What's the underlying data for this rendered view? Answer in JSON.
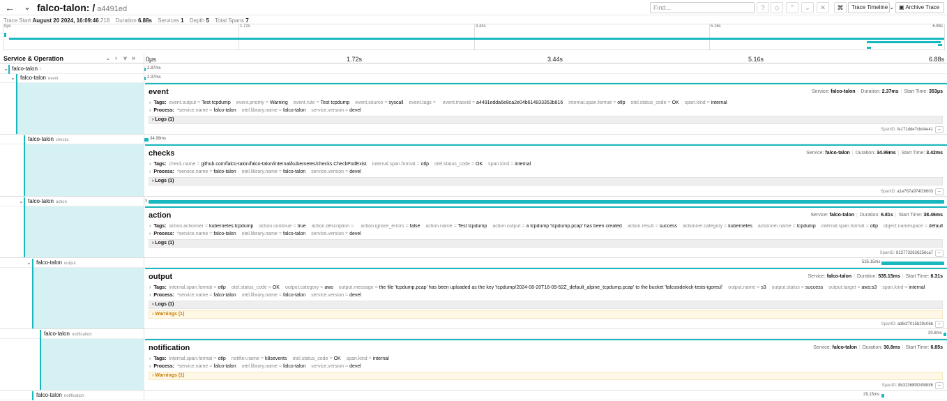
{
  "header": {
    "title": "falco-talon: /",
    "trace_id": "a4491ed",
    "find_placeholder": "Find...",
    "view_label": "Trace Timeline",
    "archive_label": "Archive Trace"
  },
  "summary": {
    "trace_start_label": "Trace Start",
    "trace_start_date": "August 20 2024, 16:09:46",
    "trace_start_ms": ".218",
    "duration_label": "Duration",
    "duration": "6.88s",
    "services_label": "Services",
    "services": "1",
    "depth_label": "Depth",
    "depth": "5",
    "spans_label": "Total Spans",
    "spans": "7"
  },
  "timeline": {
    "ticks": [
      "0μs",
      "1.72s",
      "3.44s",
      "5.16s",
      "6.88s"
    ],
    "service_operation_label": "Service & Operation"
  },
  "rows": [
    {
      "service": "falco-talon",
      "op": "/",
      "duration": "2.87ms"
    },
    {
      "service": "falco-talon",
      "op": "event",
      "duration": "2.37ms"
    },
    {
      "service": "falco-talon",
      "op": "checks",
      "duration": "34.99ms"
    },
    {
      "service": "falco-talon",
      "op": "action",
      "duration": "s"
    },
    {
      "service": "falco-talon",
      "op": "output",
      "duration": "535.15ms"
    },
    {
      "service": "falco-talon",
      "op": "notification",
      "duration": "30.8ms"
    },
    {
      "service": "falco-talon",
      "op": "notification",
      "duration": "29.15ms"
    }
  ],
  "details": {
    "labels": {
      "service": "Service:",
      "duration": "Duration:",
      "start": "Start Time:",
      "tags": "Tags:",
      "process": "Process:",
      "logs": "Logs (1)",
      "warnings": "Warnings (1)",
      "spanid": "SpanID:"
    },
    "event": {
      "title": "event",
      "service": "falco-talon",
      "duration": "2.37ms",
      "start": "353μs",
      "tags": [
        {
          "k": "event.output",
          "v": "Test tcpdump"
        },
        {
          "k": "event.priority",
          "v": "Warning"
        },
        {
          "k": "event.rule",
          "v": "Test tcpdump"
        },
        {
          "k": "event.source",
          "v": "syscall"
        },
        {
          "k": "event.tags",
          "v": ""
        },
        {
          "k": "event.traceid",
          "v": "a4491edda6e8ca2e04b614833353b816"
        },
        {
          "k": "internal.span.format",
          "v": "otlp"
        },
        {
          "k": "otel.status_code",
          "v": "OK"
        },
        {
          "k": "span.kind",
          "v": "internal"
        }
      ],
      "spanid": "fe171dde7cbd4e41"
    },
    "checks": {
      "title": "checks",
      "service": "falco-talon",
      "duration": "34.99ms",
      "start": "3.42ms",
      "tags": [
        {
          "k": "check.name",
          "v": "github.com/falco-talon/falco-talon/internal/kubernetes/checks.CheckPodExist"
        },
        {
          "k": "internal.span.format",
          "v": "otlp"
        },
        {
          "k": "otel.status_code",
          "v": "OK"
        },
        {
          "k": "span.kind",
          "v": "internal"
        }
      ],
      "spanid": "a1e767a974f26603"
    },
    "action": {
      "title": "action",
      "service": "falco-talon",
      "duration": "6.81s",
      "start": "38.46ms",
      "tags": [
        {
          "k": "action.actionner",
          "v": "kubernetes:tcpdump"
        },
        {
          "k": "action.continue",
          "v": "true"
        },
        {
          "k": "action.description",
          "v": ""
        },
        {
          "k": "action.ignore_errors",
          "v": "false"
        },
        {
          "k": "action.name",
          "v": "Test tcpdump"
        },
        {
          "k": "action.output",
          "v": "a tcpdump 'tcpdump.pcap' has been created"
        },
        {
          "k": "action.result",
          "v": "success"
        },
        {
          "k": "actionner.category",
          "v": "kubernetes"
        },
        {
          "k": "actionner.name",
          "v": "tcpdump"
        },
        {
          "k": "internal.span.format",
          "v": "otlp"
        },
        {
          "k": "object.namespace",
          "v": "default..."
        }
      ],
      "spanid": "8137732626256ca7"
    },
    "output": {
      "title": "output",
      "service": "falco-talon",
      "duration": "535.15ms",
      "start": "6.31s",
      "tags": [
        {
          "k": "internal.span.format",
          "v": "otlp"
        },
        {
          "k": "otel.status_code",
          "v": "OK"
        },
        {
          "k": "output.category",
          "v": "aws"
        },
        {
          "k": "output.message",
          "v": "the file 'tcpdump.pcap' has been uploaded as the key 'tcpdump/2024-08-20T16-09-52Z_default_alpine_tcpdump.pcap' to the bucket 'falcosidekick-tests-igoreul'"
        },
        {
          "k": "output.name",
          "v": "s3"
        },
        {
          "k": "output.status",
          "v": "success"
        },
        {
          "k": "output.target",
          "v": "aws:s3"
        },
        {
          "k": "span.kind",
          "v": "internal"
        }
      ],
      "spanid": "ad6cf7015b29c06b"
    },
    "notification": {
      "title": "notification",
      "service": "falco-talon",
      "duration": "30.8ms",
      "start": "6.85s",
      "tags": [
        {
          "k": "internal.span.format",
          "v": "otlp"
        },
        {
          "k": "notifier.name",
          "v": "k8sevents"
        },
        {
          "k": "otel.status_code",
          "v": "OK"
        },
        {
          "k": "span.kind",
          "v": "internal"
        }
      ],
      "spanid": "8b32368f82458bf6"
    },
    "process": [
      {
        "k": "*service.name",
        "v": "falco-talon"
      },
      {
        "k": "otel.library.name",
        "v": "falco-talon"
      },
      {
        "k": "service.version",
        "v": "devel"
      }
    ]
  },
  "colors": {
    "accent": "#17b8be",
    "detail_bg": "#d5f1f4"
  }
}
